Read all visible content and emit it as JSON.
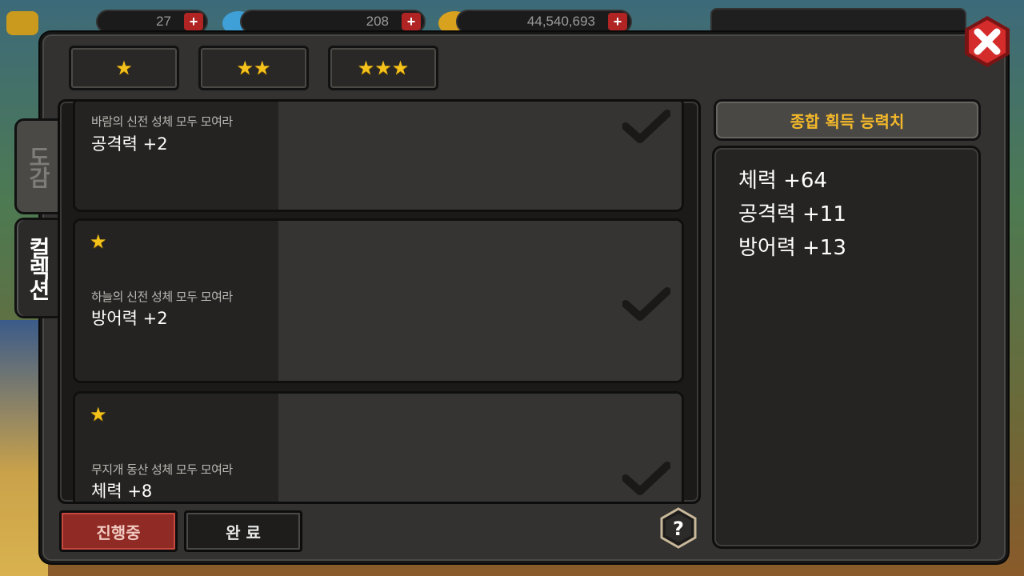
{
  "hud": {
    "item1_value": "27",
    "item2_value": "208",
    "gold_value": "44,540,693"
  },
  "star_tabs": [
    {
      "stars": "★",
      "count": 1
    },
    {
      "stars": "★★",
      "count": 2
    },
    {
      "stars": "★★★",
      "count": 3
    }
  ],
  "side_tabs": {
    "dogam": "도감",
    "collection": "컬렉션"
  },
  "cards": [
    {
      "star": "",
      "desc": "바람의 신전 성체 모두 모여라",
      "stat": "공격력 +2",
      "completed": true
    },
    {
      "star": "★",
      "desc": "하늘의 신전 성체 모두 모여라",
      "stat": "방어력 +2",
      "completed": true
    },
    {
      "star": "★",
      "desc": "무지개 동산 성체 모두 모여라",
      "stat": "체력 +8",
      "completed": true
    }
  ],
  "buttons": {
    "in_progress": "진행중",
    "complete": "완 료",
    "help": "?"
  },
  "summary": {
    "title": "종합 획득 능력치",
    "lines": [
      "체력 +64",
      "공격력 +11",
      "방어력 +13"
    ]
  },
  "colors": {
    "accent_gold": "#f4c21a",
    "summary_title": "#f4b92a",
    "active_button": "#8f2a24",
    "close_red": "#d42b2b"
  }
}
